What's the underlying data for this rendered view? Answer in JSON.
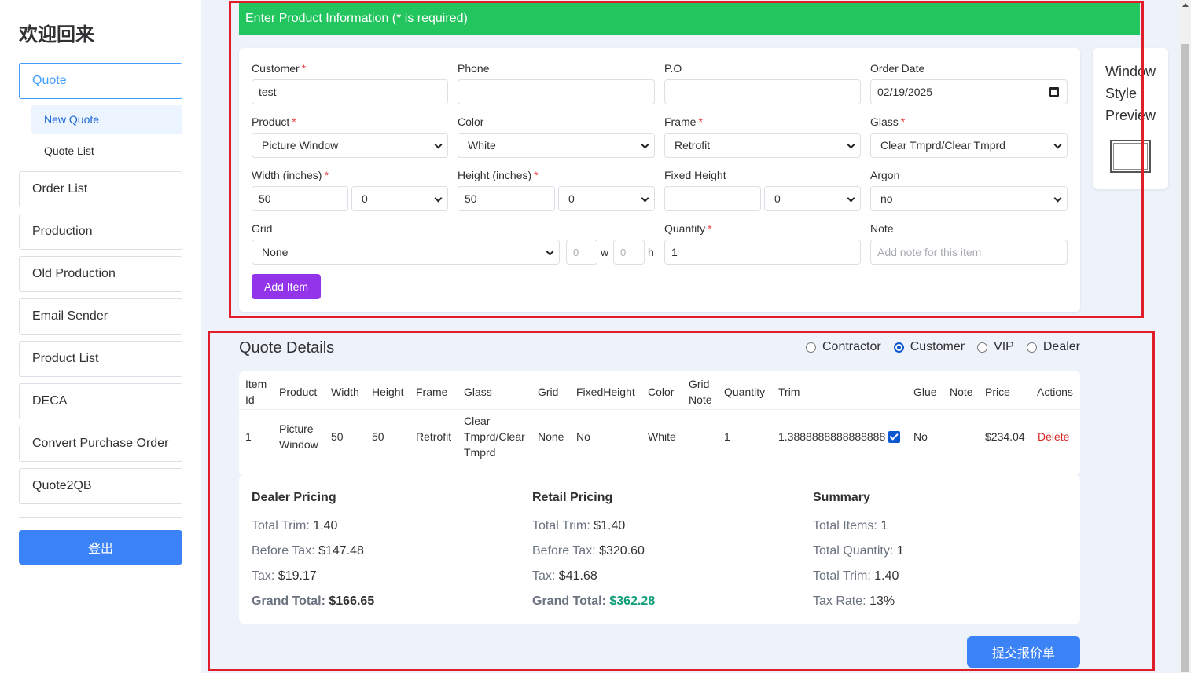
{
  "sidebar": {
    "welcome": "欢迎回来",
    "quote": "Quote",
    "new_quote": "New Quote",
    "quote_list": "Quote List",
    "items": [
      "Order List",
      "Production",
      "Old Production",
      "Email Sender",
      "Product List",
      "DECA",
      "Convert Purchase Order",
      "Quote2QB"
    ],
    "logout": "登出"
  },
  "form": {
    "header": "Enter Product Information (* is required)",
    "required_mark": "*",
    "customer_label": "Customer",
    "customer_value": "test",
    "phone_label": "Phone",
    "phone_value": "",
    "po_label": "P.O",
    "po_value": "",
    "order_date_label": "Order Date",
    "order_date_value": "02/19/2025",
    "product_label": "Product",
    "product_value": "Picture Window",
    "color_label": "Color",
    "color_value": "White",
    "frame_label": "Frame",
    "frame_value": "Retrofit",
    "glass_label": "Glass",
    "glass_value": "Clear Tmprd/Clear Tmprd",
    "width_label": "Width (inches)",
    "width_value": "50",
    "width_fraction": "0",
    "height_label": "Height (inches)",
    "height_value": "50",
    "height_fraction": "0",
    "fixed_height_label": "Fixed Height",
    "fixed_height_value": "",
    "fixed_height_fraction": "0",
    "argon_label": "Argon",
    "argon_value": "no",
    "grid_label": "Grid",
    "grid_value": "None",
    "grid_w_placeholder": "0",
    "grid_w": "w",
    "grid_h_placeholder": "0",
    "grid_h": "h",
    "quantity_label": "Quantity",
    "quantity_value": "1",
    "note_label": "Note",
    "note_placeholder": "Add note for this item",
    "add_item": "Add Item"
  },
  "preview": {
    "title": "Window Style Preview"
  },
  "quote_details": {
    "title": "Quote Details",
    "price_types": [
      {
        "label": "Contractor",
        "checked": false
      },
      {
        "label": "Customer",
        "checked": true
      },
      {
        "label": "VIP",
        "checked": false
      },
      {
        "label": "Dealer",
        "checked": false
      }
    ],
    "columns": {
      "item_id_1": "Item",
      "item_id_2": "Id",
      "product": "Product",
      "width": "Width",
      "height": "Height",
      "frame": "Frame",
      "glass": "Glass",
      "grid": "Grid",
      "fixed_height": "FixedHeight",
      "color": "Color",
      "grid_note_1": "Grid",
      "grid_note_2": "Note",
      "quantity": "Quantity",
      "trim": "Trim",
      "glue": "Glue",
      "note": "Note",
      "price": "Price",
      "actions": "Actions"
    },
    "row": {
      "item_id": "1",
      "product_1": "Picture",
      "product_2": "Window",
      "width": "50",
      "height": "50",
      "frame": "Retrofit",
      "glass_1": "Clear",
      "glass_2": "Tmprd/Clear",
      "glass_3": "Tmprd",
      "grid": "None",
      "fixed_height": "No",
      "color": "White",
      "grid_note": "",
      "quantity": "1",
      "trim": "1.3888888888888888",
      "trim_checked": true,
      "glue": "No",
      "note": "",
      "price": "$234.04",
      "action": "Delete"
    }
  },
  "pricing": {
    "dealer": {
      "title": "Dealer Pricing",
      "total_trim_label": "Total Trim:",
      "total_trim": "1.40",
      "before_tax_label": "Before Tax:",
      "before_tax": "$147.48",
      "tax_label": "Tax:",
      "tax": "$19.17",
      "grand_total_label": "Grand Total:",
      "grand_total": "$166.65"
    },
    "retail": {
      "title": "Retail Pricing",
      "total_trim_label": "Total Trim:",
      "total_trim": "$1.40",
      "before_tax_label": "Before Tax:",
      "before_tax": "$320.60",
      "tax_label": "Tax:",
      "tax": "$41.68",
      "grand_total_label": "Grand Total:",
      "grand_total": "$362.28"
    },
    "summary": {
      "title": "Summary",
      "total_items_label": "Total Items:",
      "total_items": "1",
      "total_quantity_label": "Total Quantity:",
      "total_quantity": "1",
      "total_trim_label": "Total Trim:",
      "total_trim": "1.40",
      "tax_rate_label": "Tax Rate:",
      "tax_rate": "13%"
    }
  },
  "submit": "提交报价单",
  "colors": {
    "header_green": "#22c55e",
    "add_purple": "#9333ea",
    "primary_blue": "#3b82f6",
    "highlight_red": "#e11d2a",
    "delete_red": "#dc2626",
    "grand_green": "#0f9d77"
  }
}
